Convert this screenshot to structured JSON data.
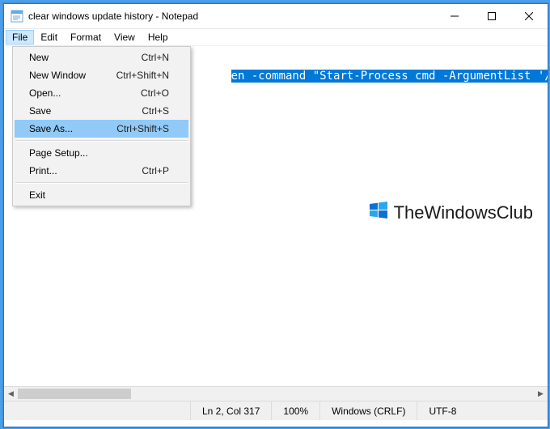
{
  "window": {
    "title": "clear windows update history - Notepad"
  },
  "menubar": [
    "File",
    "Edit",
    "Format",
    "View",
    "Help"
  ],
  "active_menu_index": 0,
  "dropdown": {
    "items": [
      {
        "label": "New",
        "shortcut": "Ctrl+N",
        "kind": "item"
      },
      {
        "label": "New Window",
        "shortcut": "Ctrl+Shift+N",
        "kind": "item"
      },
      {
        "label": "Open...",
        "shortcut": "Ctrl+O",
        "kind": "item"
      },
      {
        "label": "Save",
        "shortcut": "Ctrl+S",
        "kind": "item"
      },
      {
        "label": "Save As...",
        "shortcut": "Ctrl+Shift+S",
        "kind": "item",
        "highlight": true
      },
      {
        "kind": "sep"
      },
      {
        "label": "Page Setup...",
        "shortcut": "",
        "kind": "item"
      },
      {
        "label": "Print...",
        "shortcut": "Ctrl+P",
        "kind": "item"
      },
      {
        "kind": "sep"
      },
      {
        "label": "Exit",
        "shortcut": "",
        "kind": "item"
      }
    ]
  },
  "editor": {
    "visible_text": "en -command \"Start-Process cmd -ArgumentList '/s,/c,"
  },
  "watermark": "TheWindowsClub",
  "status": {
    "pos": "Ln 2, Col 317",
    "zoom": "100%",
    "eol": "Windows (CRLF)",
    "enc": "UTF-8"
  }
}
